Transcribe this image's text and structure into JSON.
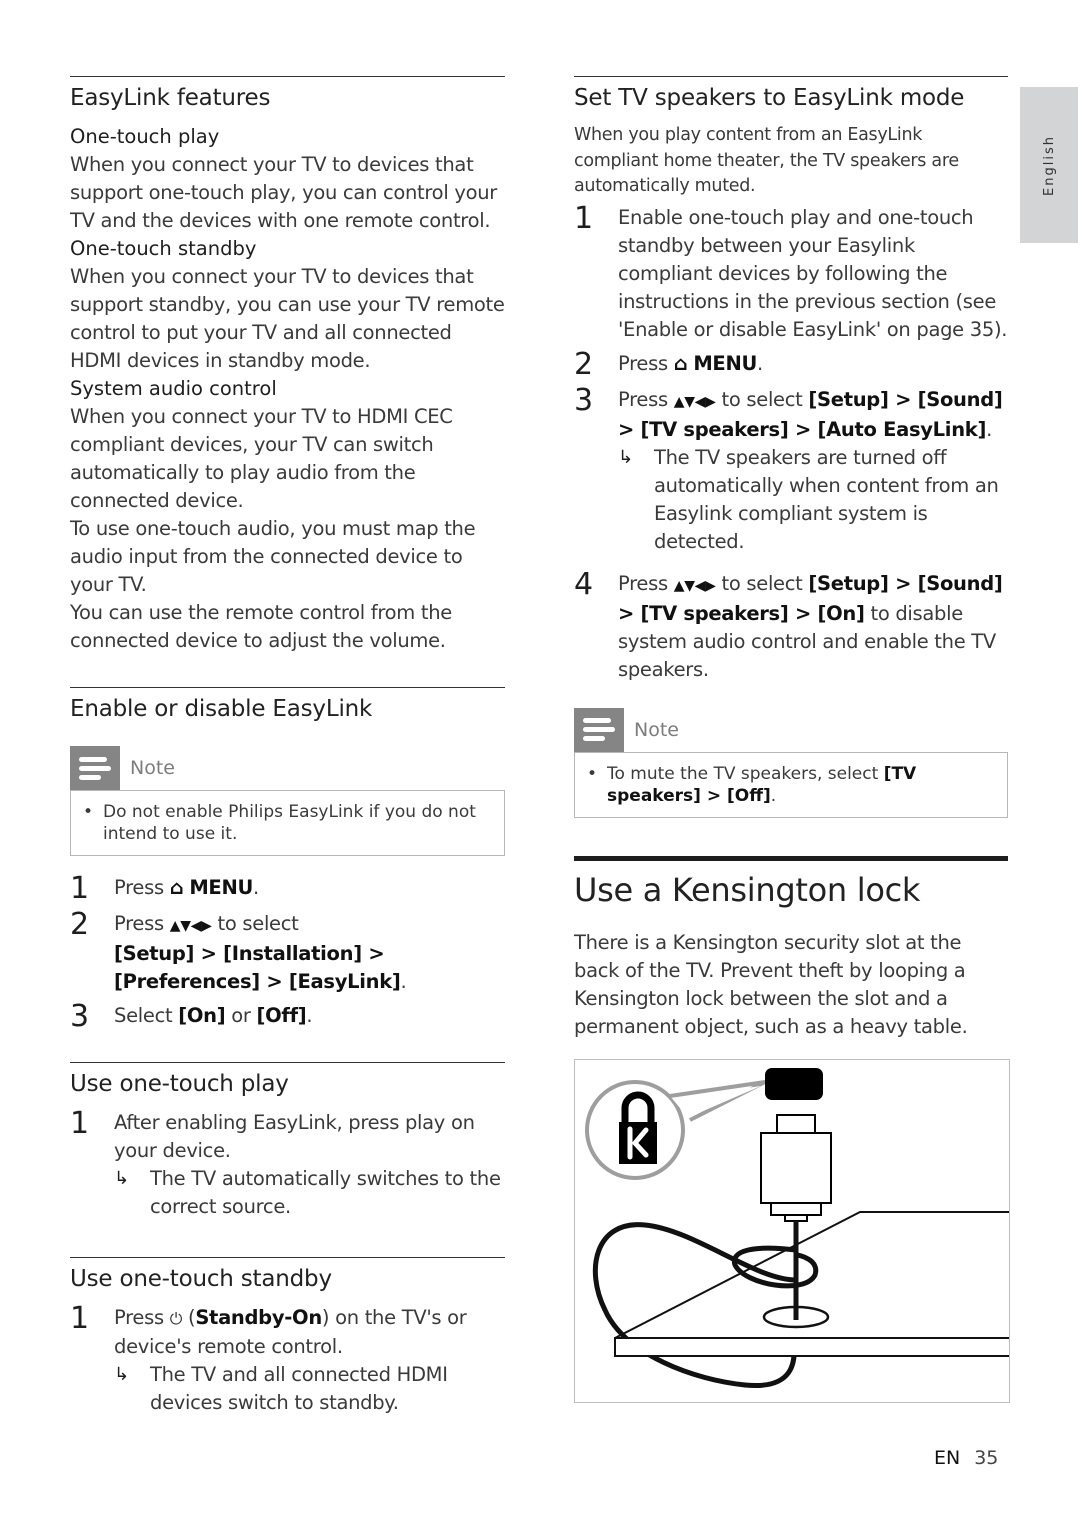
{
  "language_tab": "English",
  "footer": {
    "lang": "EN",
    "page": "35"
  },
  "left": {
    "easylink_features": {
      "title": "EasyLink features",
      "one_touch_play": {
        "subtitle": "One-touch play",
        "text": "When you connect your TV to devices that support one-touch play, you can control your TV and the devices with one remote control."
      },
      "one_touch_standby": {
        "subtitle": "One-touch standby",
        "text": "When you connect your TV to devices that support standby, you can use your TV remote control to put your TV and all connected HDMI devices in standby mode."
      },
      "system_audio": {
        "subtitle": "System audio control",
        "text1": "When you connect your TV to HDMI CEC compliant devices, your TV can switch automatically to play audio from the connected device.",
        "text2": "To use one-touch audio, you must map the audio input from the connected device to your TV.",
        "text3": "You can use the remote control from the connected device to adjust the volume."
      }
    },
    "enable_disable": {
      "title": "Enable or disable EasyLink",
      "note_label": "Note",
      "note_text": "Do not enable Philips EasyLink if you do not intend to use it.",
      "steps": [
        {
          "num": "1",
          "pre": "Press ",
          "icon": "⌂",
          "key": "MENU",
          "post": "."
        },
        {
          "num": "2",
          "pre": "Press ",
          "arrows": "▲▼◀▶",
          "mid": " to select",
          "path": "[Setup] > [Installation] > [Preferences] > [EasyLink]",
          "post": "."
        },
        {
          "num": "3",
          "pre": "Select ",
          "opt1": "[On]",
          "mid": " or ",
          "opt2": "[Off]",
          "post": "."
        }
      ]
    },
    "one_touch_play": {
      "title": "Use one-touch play",
      "step_num": "1",
      "step_text": "After enabling EasyLink, press play on your device.",
      "result_arrow": "↳",
      "result": "The TV automatically switches to the correct source."
    },
    "one_touch_standby": {
      "title": "Use one-touch standby",
      "step_num": "1",
      "pre": "Press ",
      "icon": "⏻",
      "key": "Standby-On",
      "post": " on the TV's or device's remote control.",
      "result_arrow": "↳",
      "result": "The TV and all connected HDMI devices switch to standby."
    }
  },
  "right": {
    "tv_speakers": {
      "title": "Set TV speakers to EasyLink mode",
      "intro": "When you play content from an EasyLink compliant home theater, the TV speakers are automatically muted.",
      "step1": {
        "num": "1",
        "text": "Enable one-touch play and one-touch standby between your Easylink compliant devices by following the instructions in the previous section (see 'Enable or disable EasyLink' on page 35)."
      },
      "step2": {
        "num": "2",
        "pre": "Press ",
        "icon": "⌂",
        "key": "MENU",
        "post": "."
      },
      "step3": {
        "num": "3",
        "pre": "Press ",
        "arrows": "▲▼◀▶",
        "mid": " to select ",
        "path": "[Setup] > [Sound] > [TV speakers] > [Auto EasyLink]",
        "post": ".",
        "result_arrow": "↳",
        "result": "The TV speakers are turned off automatically when content from an Easylink compliant system is detected."
      },
      "step4": {
        "num": "4",
        "pre": "Press ",
        "arrows": "▲▼◀▶",
        "mid": " to select ",
        "path": "[Setup] > [Sound] > [TV speakers] > [On]",
        "post": " to disable system audio control and enable the TV speakers."
      },
      "note_label": "Note",
      "note_pre": "To mute the TV speakers, select ",
      "note_path": "[TV speakers] > [Off]",
      "note_post": "."
    },
    "kensington": {
      "title": "Use a Kensington lock",
      "text": "There is a Kensington security slot at the back of the TV. Prevent theft by looping a Kensington lock between the slot and a permanent object, such as a heavy table.",
      "illustration": "kensington-lock-illustration"
    }
  }
}
